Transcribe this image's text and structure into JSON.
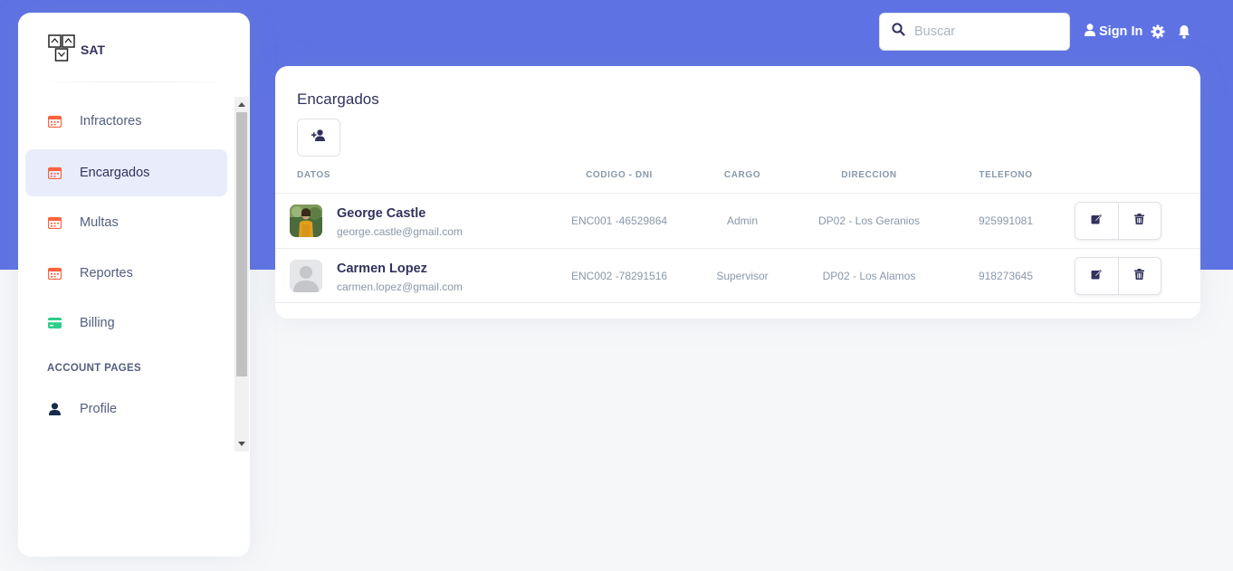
{
  "sidebar": {
    "brand": "SAT",
    "items": [
      {
        "label": "Infractores",
        "icon": "calendar-icon"
      },
      {
        "label": "Encargados",
        "icon": "calendar-icon",
        "active": true
      },
      {
        "label": "Multas",
        "icon": "calendar-icon"
      },
      {
        "label": "Reportes",
        "icon": "calendar-icon"
      },
      {
        "label": "Billing",
        "icon": "credit-card-icon"
      }
    ],
    "account_section": "ACCOUNT PAGES",
    "account_items": [
      {
        "label": "Profile",
        "icon": "user-icon"
      }
    ]
  },
  "topnav": {
    "search_placeholder": "Buscar",
    "signin_label": "Sign In"
  },
  "card": {
    "title": "Encargados",
    "columns": [
      "DATOS",
      "CODIGO - DNI",
      "CARGO",
      "DIRECCION",
      "TELEFONO"
    ],
    "rows": [
      {
        "name": "George Castle",
        "email": "george.castle@gmail.com",
        "codigo": "ENC001 -46529864",
        "cargo": "Admin",
        "direccion": "DP02 - Los Geranios",
        "telefono": "925991081"
      },
      {
        "name": "Carmen Lopez",
        "email": "carmen.lopez@gmail.com",
        "codigo": "ENC002 -78291516",
        "cargo": "Supervisor",
        "direccion": "DP02 - Los Alamos",
        "telefono": "918273645"
      }
    ]
  },
  "colors": {
    "primary": "#5e72e4",
    "calendar_icon": "#f5365c",
    "billing_icon": "#2dce89",
    "active_bg": "#e9ecfb"
  }
}
